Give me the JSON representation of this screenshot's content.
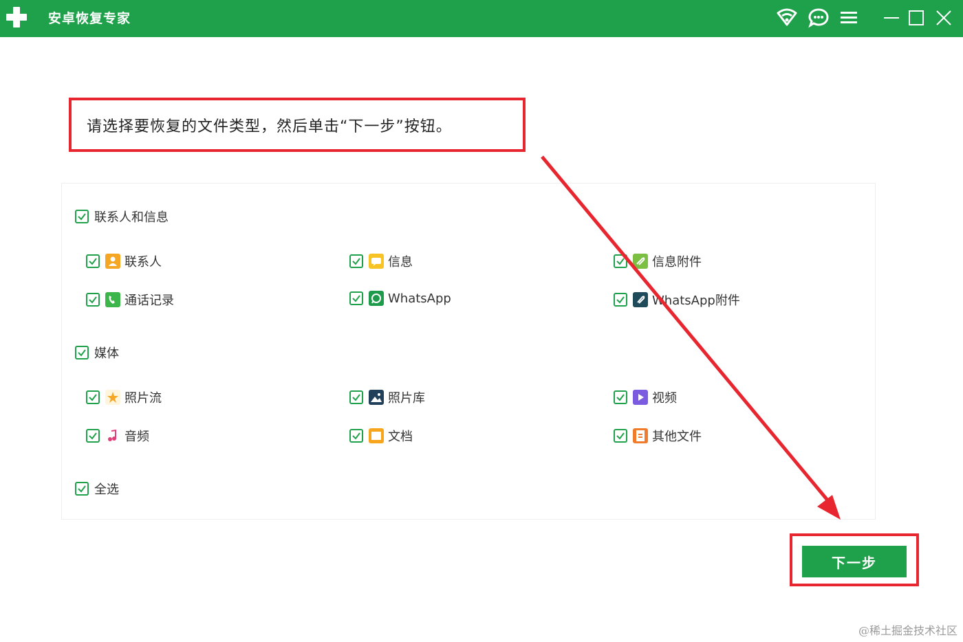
{
  "titlebar": {
    "app_title": "安卓恢复专家",
    "icons": [
      "app-logo-plus-icon",
      "wifi-icon",
      "chat-icon",
      "menu-icon",
      "minimize-icon",
      "maximize-icon",
      "close-icon"
    ],
    "accent_color": "#1fa04a"
  },
  "instruction": {
    "text": "请选择要恢复的文件类型，然后单击“下一步”按钮。",
    "highlight_color": "#e8262f"
  },
  "groups": {
    "contacts_messages": {
      "label": "联系人和信息",
      "items": [
        {
          "label": "联系人",
          "icon": "contacts-icon",
          "checked": true
        },
        {
          "label": "信息",
          "icon": "message-icon",
          "checked": true
        },
        {
          "label": "信息附件",
          "icon": "message-attachment-icon",
          "checked": true
        },
        {
          "label": "通话记录",
          "icon": "call-log-icon",
          "checked": true
        },
        {
          "label": "WhatsApp",
          "icon": "whatsapp-icon",
          "checked": true
        },
        {
          "label": "WhatsApp附件",
          "icon": "whatsapp-attachment-icon",
          "checked": true
        }
      ]
    },
    "media": {
      "label": "媒体",
      "items": [
        {
          "label": "照片流",
          "icon": "photo-stream-icon",
          "checked": true
        },
        {
          "label": "照片库",
          "icon": "photo-library-icon",
          "checked": true
        },
        {
          "label": "视频",
          "icon": "video-icon",
          "checked": true
        },
        {
          "label": "音频",
          "icon": "audio-icon",
          "checked": true
        },
        {
          "label": "文档",
          "icon": "document-icon",
          "checked": true
        },
        {
          "label": "其他文件",
          "icon": "other-files-icon",
          "checked": true
        }
      ]
    },
    "select_all": {
      "label": "全选",
      "checked": true
    }
  },
  "actions": {
    "next_label": "下一步"
  },
  "watermark": "@稀土掘金技术社区"
}
